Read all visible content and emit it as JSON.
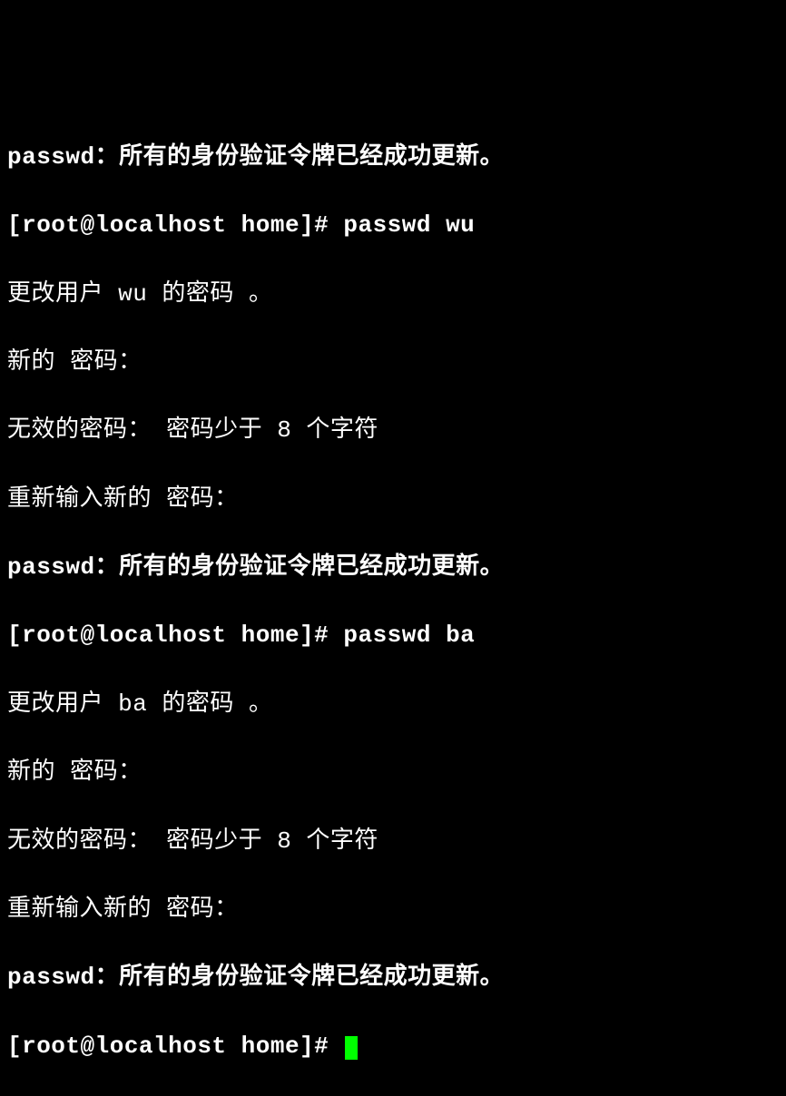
{
  "lines": {
    "l0": "passwd：所有的身份验证令牌已经成功更新。",
    "l1_prompt": "[root@localhost home]# ",
    "l1_cmd": "passwd wu",
    "l2": "更改用户 wu 的密码 。",
    "l3": "新的 密码：",
    "l4": "无效的密码： 密码少于 8 个字符",
    "l5": "重新输入新的 密码：",
    "l6": "passwd：所有的身份验证令牌已经成功更新。",
    "l7_prompt": "[root@localhost home]# ",
    "l7_cmd": "passwd ba",
    "l8": "更改用户 ba 的密码 。",
    "l9": "新的 密码：",
    "l10": "无效的密码： 密码少于 8 个字符",
    "l11": "重新输入新的 密码：",
    "l12": "passwd：所有的身份验证令牌已经成功更新。",
    "l13_prompt": "[root@localhost home]# "
  }
}
